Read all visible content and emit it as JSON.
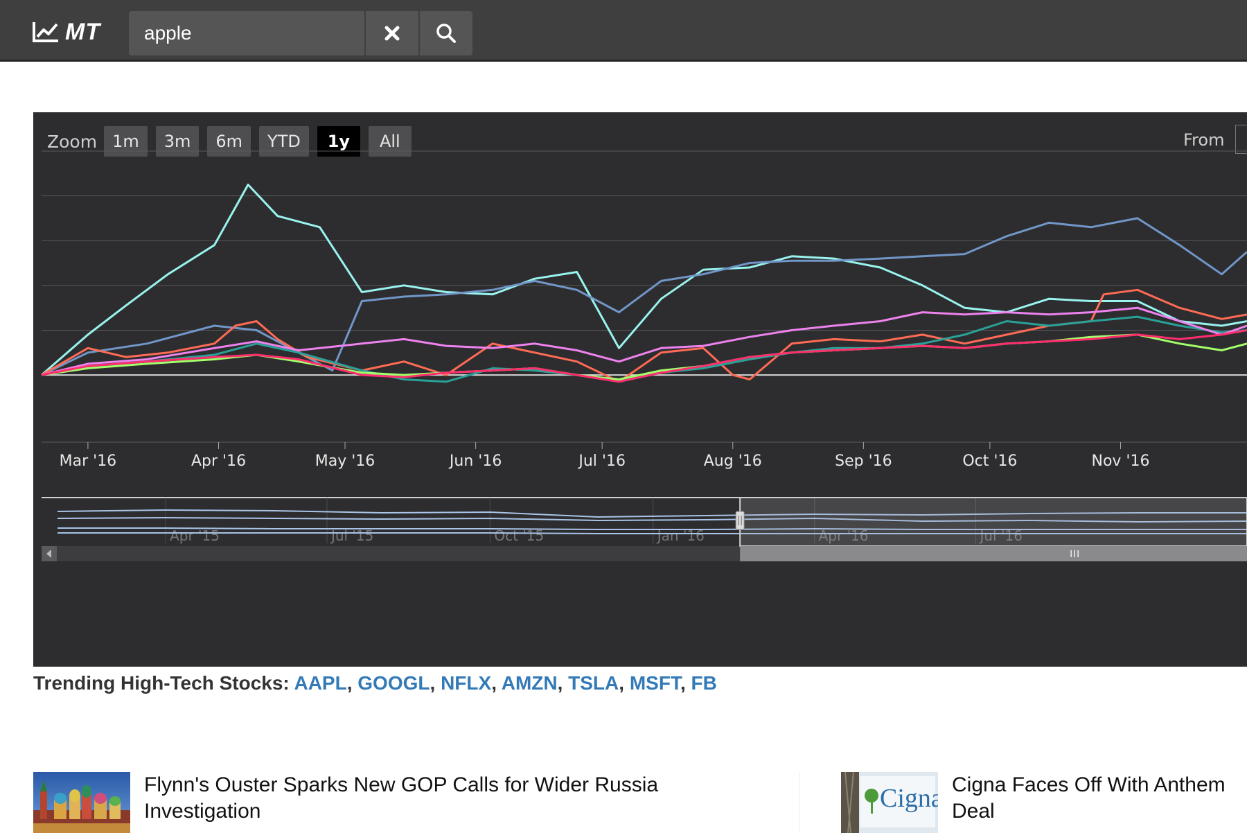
{
  "app": {
    "logo_text": "MT",
    "logo_icon": "line-chart-icon",
    "search": {
      "value": "apple",
      "placeholder": ""
    },
    "clear_icon": "close-icon",
    "search_icon": "search-icon"
  },
  "chart": {
    "zoom_label": "Zoom",
    "zoom_buttons": [
      "1m",
      "3m",
      "6m",
      "YTD",
      "1y",
      "All"
    ],
    "zoom_selected": "1y",
    "from_label": "From"
  },
  "chart_data": {
    "type": "line",
    "title": "",
    "xlabel": "",
    "ylabel": "",
    "x_ticks": [
      "Mar '16",
      "Apr '16",
      "May '16",
      "Jun '16",
      "Jul '16",
      "Aug '16",
      "Sep '16",
      "Oct '16",
      "Nov '16"
    ],
    "x_range": [
      "2016-02-19",
      "2016-12-01"
    ],
    "grid": true,
    "legend": "none",
    "series": [
      {
        "color": "#99f3ee",
        "x": [
          "2016-02-19",
          "2016-03-01",
          "2016-03-10",
          "2016-03-20",
          "2016-03-31",
          "2016-04-08",
          "2016-04-15",
          "2016-04-25",
          "2016-05-05",
          "2016-05-15",
          "2016-05-25",
          "2016-06-05",
          "2016-06-15",
          "2016-06-25",
          "2016-07-05",
          "2016-07-15",
          "2016-07-25",
          "2016-08-05",
          "2016-08-15",
          "2016-08-25",
          "2016-09-05",
          "2016-09-15",
          "2016-09-25",
          "2016-10-05",
          "2016-10-15",
          "2016-10-25",
          "2016-11-05",
          "2016-11-15",
          "2016-11-25",
          "2016-12-01"
        ],
        "values": [
          0,
          18,
          31,
          45,
          58,
          85,
          71,
          66,
          37,
          40,
          37,
          36,
          43,
          46,
          12,
          34,
          47,
          48,
          53,
          52,
          48,
          40,
          30,
          28,
          34,
          33,
          33,
          24,
          22,
          24
        ]
      },
      {
        "color": "#7196c8",
        "x": [
          "2016-02-19",
          "2016-03-01",
          "2016-03-15",
          "2016-03-31",
          "2016-04-10",
          "2016-04-20",
          "2016-04-28",
          "2016-05-05",
          "2016-05-15",
          "2016-05-25",
          "2016-06-05",
          "2016-06-15",
          "2016-06-25",
          "2016-07-05",
          "2016-07-15",
          "2016-07-25",
          "2016-08-05",
          "2016-08-15",
          "2016-08-25",
          "2016-09-05",
          "2016-09-15",
          "2016-09-25",
          "2016-10-05",
          "2016-10-15",
          "2016-10-25",
          "2016-11-05",
          "2016-11-15",
          "2016-11-25",
          "2016-12-01"
        ],
        "values": [
          0,
          10,
          14,
          22,
          20,
          10,
          2,
          33,
          35,
          36,
          38,
          42,
          38,
          28,
          42,
          45,
          50,
          51,
          51,
          52,
          53,
          54,
          62,
          68,
          66,
          70,
          58,
          45,
          55
        ]
      },
      {
        "color": "#ff6b55",
        "x": [
          "2016-02-19",
          "2016-03-01",
          "2016-03-10",
          "2016-03-20",
          "2016-03-31",
          "2016-04-05",
          "2016-04-10",
          "2016-04-15",
          "2016-04-22",
          "2016-05-05",
          "2016-05-15",
          "2016-05-25",
          "2016-06-05",
          "2016-06-15",
          "2016-06-25",
          "2016-07-05",
          "2016-07-15",
          "2016-07-25",
          "2016-08-01",
          "2016-08-05",
          "2016-08-15",
          "2016-08-25",
          "2016-09-05",
          "2016-09-15",
          "2016-09-25",
          "2016-10-05",
          "2016-10-15",
          "2016-10-25",
          "2016-10-28",
          "2016-11-05",
          "2016-11-15",
          "2016-11-25",
          "2016-12-01"
        ],
        "values": [
          0,
          12,
          8,
          10,
          14,
          22,
          24,
          16,
          8,
          2,
          6,
          0,
          14,
          10,
          6,
          -3,
          10,
          12,
          0,
          -2,
          14,
          16,
          15,
          18,
          14,
          18,
          22,
          24,
          36,
          38,
          30,
          25,
          27
        ]
      },
      {
        "color": "#2aa198",
        "x": [
          "2016-02-19",
          "2016-03-01",
          "2016-03-15",
          "2016-03-31",
          "2016-04-10",
          "2016-04-20",
          "2016-05-05",
          "2016-05-15",
          "2016-05-25",
          "2016-06-05",
          "2016-06-15",
          "2016-06-25",
          "2016-07-05",
          "2016-07-15",
          "2016-07-25",
          "2016-08-05",
          "2016-08-15",
          "2016-08-25",
          "2016-09-05",
          "2016-09-15",
          "2016-09-25",
          "2016-10-05",
          "2016-10-15",
          "2016-10-25",
          "2016-11-05",
          "2016-11-15",
          "2016-11-25",
          "2016-12-01"
        ],
        "values": [
          0,
          4,
          6,
          9,
          14,
          10,
          2,
          -2,
          -3,
          3,
          2,
          0,
          -3,
          1,
          3,
          7,
          10,
          12,
          12,
          14,
          18,
          24,
          22,
          24,
          26,
          22,
          19,
          20
        ]
      },
      {
        "color": "#a3ff6b",
        "x": [
          "2016-02-19",
          "2016-03-01",
          "2016-03-15",
          "2016-03-31",
          "2016-04-10",
          "2016-04-20",
          "2016-05-05",
          "2016-05-15",
          "2016-05-25",
          "2016-06-05",
          "2016-06-15",
          "2016-06-25",
          "2016-07-05",
          "2016-07-15",
          "2016-07-25",
          "2016-08-05",
          "2016-08-15",
          "2016-08-25",
          "2016-09-05",
          "2016-09-15",
          "2016-09-25",
          "2016-10-05",
          "2016-10-15",
          "2016-10-25",
          "2016-11-05",
          "2016-11-15",
          "2016-11-25",
          "2016-12-01"
        ],
        "values": [
          0,
          3,
          5,
          7,
          9,
          6,
          1,
          0,
          1,
          2,
          3,
          0,
          -2,
          2,
          4,
          8,
          10,
          11,
          12,
          13,
          12,
          14,
          15,
          17,
          18,
          14,
          11,
          14
        ]
      },
      {
        "color": "#ee82ee",
        "x": [
          "2016-02-19",
          "2016-03-01",
          "2016-03-15",
          "2016-03-31",
          "2016-04-10",
          "2016-04-20",
          "2016-05-05",
          "2016-05-15",
          "2016-05-25",
          "2016-06-05",
          "2016-06-15",
          "2016-06-25",
          "2016-07-05",
          "2016-07-15",
          "2016-07-25",
          "2016-08-05",
          "2016-08-15",
          "2016-08-25",
          "2016-09-05",
          "2016-09-15",
          "2016-09-25",
          "2016-10-05",
          "2016-10-15",
          "2016-10-25",
          "2016-11-05",
          "2016-11-15",
          "2016-11-25",
          "2016-12-01"
        ],
        "values": [
          0,
          5,
          7,
          12,
          15,
          11,
          14,
          16,
          13,
          12,
          14,
          11,
          6,
          12,
          13,
          17,
          20,
          22,
          24,
          28,
          27,
          28,
          27,
          28,
          30,
          24,
          18,
          22
        ]
      },
      {
        "color": "#ff2d6e",
        "x": [
          "2016-02-19",
          "2016-03-01",
          "2016-03-15",
          "2016-03-31",
          "2016-04-10",
          "2016-04-20",
          "2016-05-05",
          "2016-05-15",
          "2016-05-25",
          "2016-06-05",
          "2016-06-15",
          "2016-06-25",
          "2016-07-05",
          "2016-07-15",
          "2016-07-25",
          "2016-08-05",
          "2016-08-15",
          "2016-08-25",
          "2016-09-05",
          "2016-09-15",
          "2016-09-25",
          "2016-10-05",
          "2016-10-15",
          "2016-10-25",
          "2016-11-05",
          "2016-11-15",
          "2016-11-25",
          "2016-12-01"
        ],
        "values": [
          0,
          4,
          6,
          8,
          9,
          7,
          0,
          -1,
          1,
          2,
          3,
          0,
          -3,
          1,
          4,
          8,
          10,
          11,
          12,
          13,
          12,
          14,
          15,
          16,
          18,
          16,
          18,
          20
        ]
      }
    ],
    "navigator": {
      "x_ticks": [
        "Apr '15",
        "Jul '15",
        "Oct '15",
        "Jan '16",
        "Apr '16",
        "Jul '16"
      ],
      "selected_range": [
        "2016-02-19",
        "2016-12-01"
      ]
    }
  },
  "trending": {
    "label": "Trending High-Tech Stocks:",
    "tickers": [
      "AAPL",
      "GOOGL",
      "NFLX",
      "AMZN",
      "TSLA",
      "MSFT",
      "FB"
    ],
    "link_color": "#337ab7"
  },
  "news": [
    {
      "title_line1": "Flynn's Ouster Sparks New GOP Calls for Wider Russia",
      "title_line2": "Investigation"
    },
    {
      "title_line1": "Cigna Faces Off With Anthem",
      "title_line2": "Deal",
      "thumb_text": "Cigna"
    }
  ]
}
